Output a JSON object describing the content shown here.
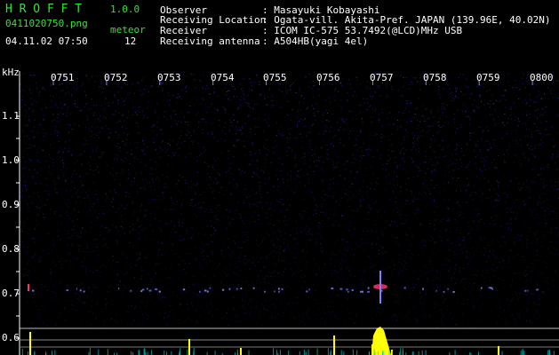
{
  "app": {
    "name": "H R O F F T",
    "version": "1.0.0"
  },
  "file": {
    "name": "0411020750.png",
    "datetime": "04.11.02 07:50"
  },
  "meteor": {
    "label": "meteor",
    "count": "12"
  },
  "info": [
    {
      "label": "Observer",
      "value": ": Masayuki Kobayashi"
    },
    {
      "label": "Receiving Location",
      "value": ": Ogata-vill. Akita-Pref. JAPAN (139.96E, 40.02N)"
    },
    {
      "label": "Receiver",
      "value": ": ICOM IC-575 53.7492(@LCD)MHz USB"
    },
    {
      "label": "Receiving antenna",
      "value": ": A504HB(yagi 4el)"
    }
  ],
  "axis": {
    "unit": "kHz",
    "time_ticks": [
      "0751",
      "0752",
      "0753",
      "0754",
      "0755",
      "0756",
      "0757",
      "0758",
      "0759",
      "0800"
    ],
    "freq_ticks": [
      "1.1",
      "1.0",
      "0.9",
      "0.8",
      "0.7",
      "0.6"
    ]
  },
  "colors": {
    "header_green": "#2ee82e",
    "background": "#000000",
    "noise": "#1a1a7a",
    "signal": "#ffff00",
    "meteor_echo": "#ff3070"
  }
}
